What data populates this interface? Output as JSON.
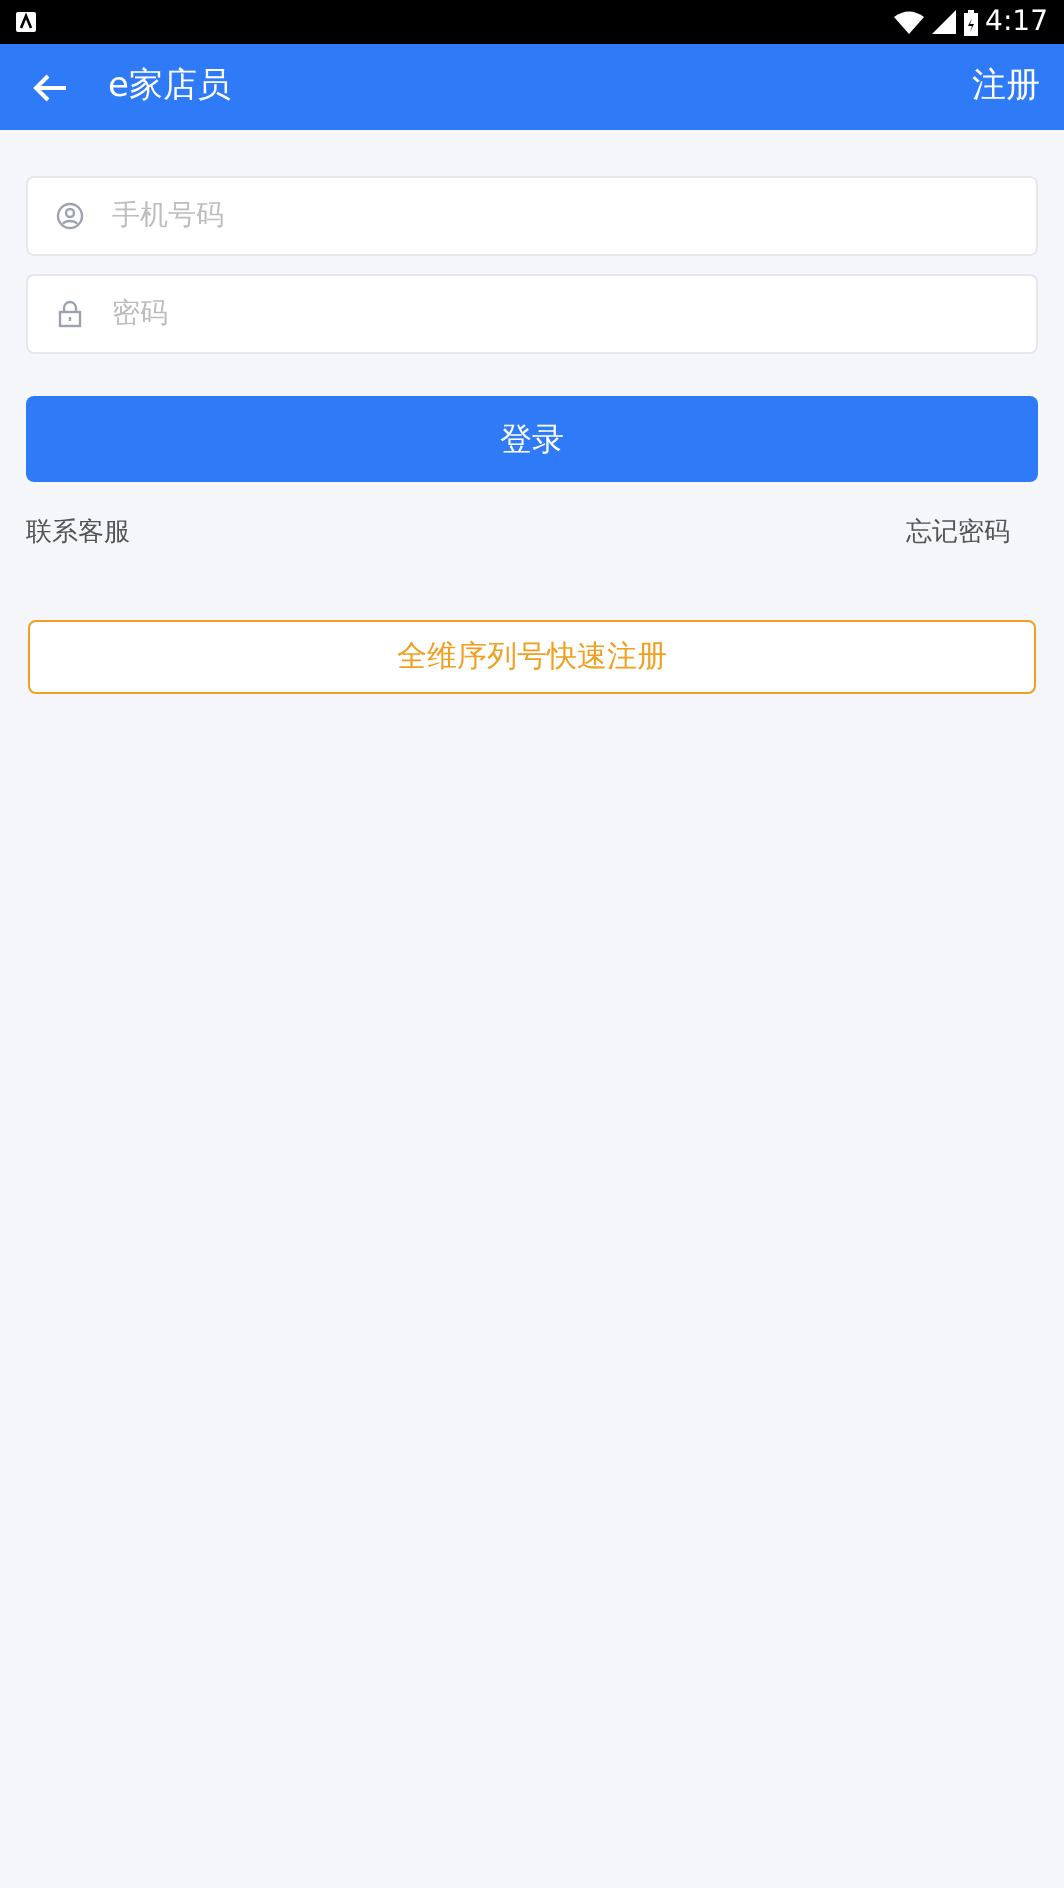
{
  "status_bar": {
    "time": "4:17"
  },
  "app_bar": {
    "title": "e家店员",
    "action": "注册"
  },
  "fields": [
    {
      "kind": "phone",
      "placeholder": "手机号码"
    },
    {
      "kind": "password",
      "placeholder": "密码"
    }
  ],
  "login_button": "登录",
  "links": {
    "left": "联系客服",
    "right": "忘记密码"
  },
  "register_button": "全维序列号快速注册"
}
